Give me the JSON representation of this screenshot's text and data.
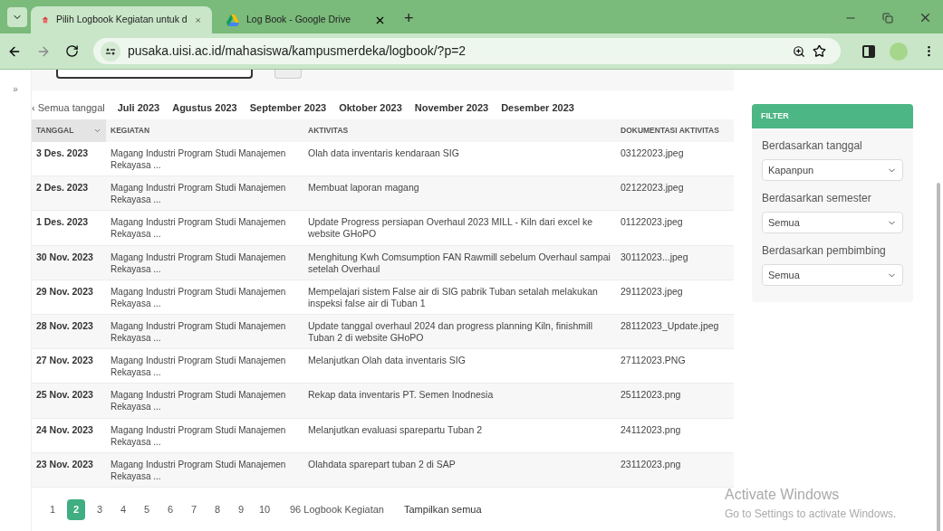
{
  "browser": {
    "tabs": [
      {
        "title": "Pilih Logbook Kegiatan untuk d",
        "selected": true,
        "kind": "site"
      },
      {
        "title": "Log Book - Google Drive",
        "selected": false,
        "kind": "drive"
      }
    ],
    "new_tab": "+",
    "url": "pusaka.uisi.ac.id/mahasiswa/kampusmerdeka/logbook/?p=2"
  },
  "sidebar_toggle": "»",
  "month_filter": [
    {
      "label": "‹ Semua tanggal",
      "selected": false
    },
    {
      "label": "Juli 2023",
      "selected": false
    },
    {
      "label": "Agustus 2023",
      "selected": false
    },
    {
      "label": "September 2023",
      "selected": false
    },
    {
      "label": "Oktober 2023",
      "selected": false
    },
    {
      "label": "November 2023",
      "selected": false
    },
    {
      "label": "Desember 2023",
      "selected": false
    }
  ],
  "table": {
    "columns": [
      {
        "label": "TANGGAL",
        "sorted": true
      },
      {
        "label": "KEGIATAN",
        "sorted": false
      },
      {
        "label": "AKTIVITAS",
        "sorted": false
      },
      {
        "label": "DOKUMENTASI AKTIVITAS",
        "sorted": false
      }
    ],
    "rows": [
      {
        "date": "3 Des. 2023",
        "kegiatan": "Magang Industri Program Studi Manajemen Rekayasa ...",
        "aktivitas": "Olah data inventaris kendaraan SIG",
        "file": "03122023.jpeg"
      },
      {
        "date": "2 Des. 2023",
        "kegiatan": "Magang Industri Program Studi Manajemen Rekayasa ...",
        "aktivitas": "Membuat laporan magang",
        "file": "02122023.jpeg"
      },
      {
        "date": "1 Des. 2023",
        "kegiatan": "Magang Industri Program Studi Manajemen Rekayasa ...",
        "aktivitas": "Update Progress persiapan Overhaul 2023 MILL - Kiln dari excel ke website GHoPO",
        "file": "01122023.jpeg"
      },
      {
        "date": "30 Nov. 2023",
        "kegiatan": "Magang Industri Program Studi Manajemen Rekayasa ...",
        "aktivitas": "Menghitung Kwh Comsumption FAN Rawmill sebelum Overhaul sampai setelah Overhaul",
        "file": "30112023...jpeg"
      },
      {
        "date": "29 Nov. 2023",
        "kegiatan": "Magang Industri Program Studi Manajemen Rekayasa ...",
        "aktivitas": "Mempelajari sistem False air di SIG pabrik Tuban setalah melakukan inspeksi false air di Tuban 1",
        "file": "29112023.jpeg"
      },
      {
        "date": "28 Nov. 2023",
        "kegiatan": "Magang Industri Program Studi Manajemen Rekayasa ...",
        "aktivitas": "Update tanggal overhaul 2024 dan progress planning Kiln, finishmill Tuban 2 di website GHoPO",
        "file": "28112023_Update.jpeg"
      },
      {
        "date": "27 Nov. 2023",
        "kegiatan": "Magang Industri Program Studi Manajemen Rekayasa ...",
        "aktivitas": "Melanjutkan Olah data inventaris SIG",
        "file": "27112023.PNG"
      },
      {
        "date": "25 Nov. 2023",
        "kegiatan": "Magang Industri Program Studi Manajemen Rekayasa ...",
        "aktivitas": "Rekap data inventaris PT. Semen Inodnesia",
        "file": "25112023.png"
      },
      {
        "date": "24 Nov. 2023",
        "kegiatan": "Magang Industri Program Studi Manajemen Rekayasa ...",
        "aktivitas": "Melanjutkan evaluasi sparepartu Tuban 2",
        "file": "24112023.png"
      },
      {
        "date": "23 Nov. 2023",
        "kegiatan": "Magang Industri Program Studi Manajemen Rekayasa ...",
        "aktivitas": "Olahdata sparepart tuban 2 di SAP",
        "file": "23112023.png"
      }
    ]
  },
  "pagination": {
    "pages": [
      {
        "label": "1",
        "selected": false
      },
      {
        "label": "2",
        "selected": true
      },
      {
        "label": "3",
        "selected": false
      },
      {
        "label": "4",
        "selected": false
      },
      {
        "label": "5",
        "selected": false
      },
      {
        "label": "6",
        "selected": false
      },
      {
        "label": "7",
        "selected": false
      },
      {
        "label": "8",
        "selected": false
      },
      {
        "label": "9",
        "selected": false
      },
      {
        "label": "10",
        "selected": false
      }
    ],
    "count": "96 Logbook Kegiatan",
    "show_all": "Tampilkan semua"
  },
  "filter": {
    "title": "FILTER",
    "groups": [
      {
        "label": "Berdasarkan tanggal",
        "value": "Kapanpun"
      },
      {
        "label": "Berdasarkan semester",
        "value": "Semua"
      },
      {
        "label": "Berdasarkan pembimbing",
        "value": "Semua"
      }
    ]
  },
  "os_notice": {
    "title": "Activate Windows",
    "text": "Go to Settings to activate Windows."
  }
}
